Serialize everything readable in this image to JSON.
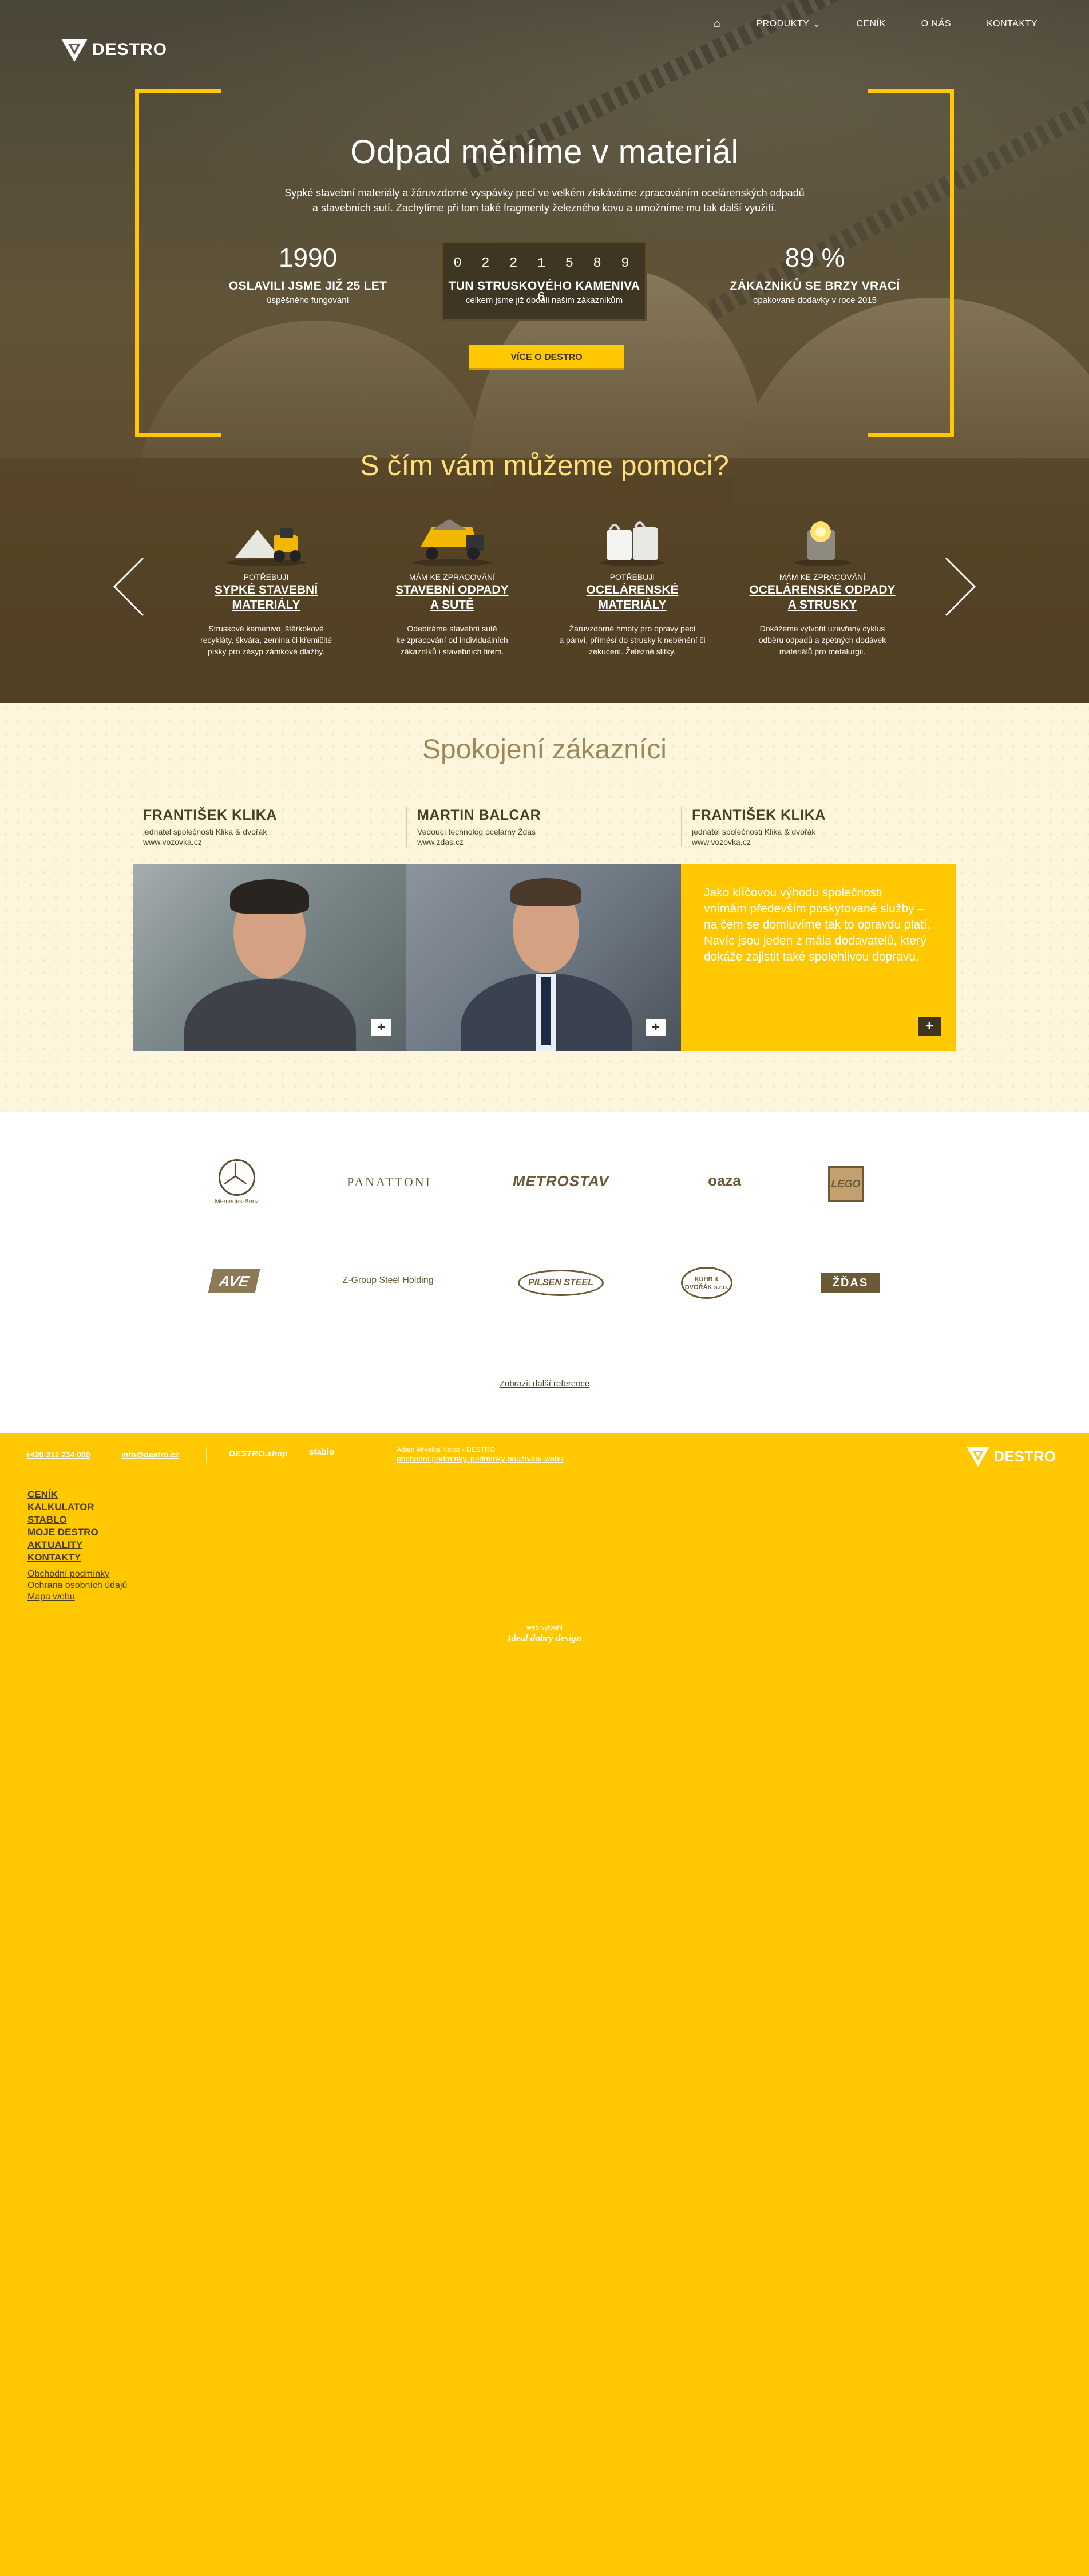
{
  "brand": {
    "name": "DESTRO"
  },
  "nav": {
    "home_icon": "home-icon",
    "items": [
      "PRODUKTY",
      "CENÍK",
      "O NÁS",
      "KONTAKTY"
    ]
  },
  "hero": {
    "title": "Odpad měníme v materiál",
    "subtitle_line1": "Sypké stavební materiály a žáruvzdorné vyspávky pecí ve velkém získáváme zpracováním ocelárenských odpadů",
    "subtitle_line2": "a stavebních sutí. Zachytíme při tom také fragmenty železného kovu a umožníme mu tak další využití.",
    "stats": [
      {
        "value": "1990",
        "label": "OSLAVILI JSME JIŽ 25 LET",
        "desc": "úspěšného fungování"
      },
      {
        "value": "0 2 2 1 5 8 9 6",
        "label": "TUN STRUSKOVÉHO KAMENIVA",
        "desc": "celkem jsme již dodali našim zákazníkům"
      },
      {
        "value": "89 %",
        "label": "ZÁKAZNÍKŮ SE BRZY VRACÍ",
        "desc": "opakované dodávky v roce 2015"
      }
    ],
    "button": "VÍCE O DESTRO"
  },
  "help": {
    "title": "S čím vám můžeme pomoci?",
    "cards": [
      {
        "pre": "POTŘEBUJI",
        "name1": "SYPKÉ STAVEBNÍ",
        "name2": "MATERIÁLY",
        "t1": "Struskové kamenivo, štěrkokové",
        "t2": "recykláty, škvára, zemina či křemičité",
        "t3": "písky pro zásyp zámkové dlažby."
      },
      {
        "pre": "MÁM KE ZPRACOVÁNÍ",
        "name1": "STAVEBNÍ ODPADY",
        "name2": "A SUTĚ",
        "t1": "Odebíráme stavební sutě",
        "t2": "ke zpracování od individuálních",
        "t3": "zákazníků i stavebních firem."
      },
      {
        "pre": "POTŘEBUJI",
        "name1": "OCELÁRENSKÉ",
        "name2": "MATERIÁLY",
        "t1": "Žáruvzdorné hmoty pro opravy pecí",
        "t2": "a pánví, přímésí do strusky k neběnéní či",
        "t3": "zekucení. Železné slitky."
      },
      {
        "pre": "MÁM KE ZPRACOVÁNÍ",
        "name1": "OCELÁRENSKÉ ODPADY",
        "name2": "A STRUSKY",
        "t1": "Dokážeme vytvořit uzavřený cyklus",
        "t2": "odběru odpadů a zpětných dodávek",
        "t3": "materiálů pro metalurgii."
      }
    ]
  },
  "testimonials": {
    "title": "Spokojení zákazníci",
    "people": [
      {
        "name": "FRANTIŠEK KLIKA",
        "role": "jednatel společnosti Klika & dvořák",
        "link": "www.vozovka.cz"
      },
      {
        "name": "MARTIN BALCAR",
        "role": "Vedoucí technolog ocelárny Ždas",
        "link": "www.zdas.cz"
      },
      {
        "name": "FRANTIŠEK KLIKA",
        "role": "jednatel společnosti Klika & dvořák",
        "link": "www.vozovka.cz"
      }
    ],
    "quote": [
      "Jako klíčovou výhodu společnosti",
      "vnímám především poskytované služby –",
      "na čem se domluvíme tak to opravdu platí.",
      "Navíc jsou jeden z mála dodavatelů, který",
      "dokáže zajistit také spolehlivou dopravu."
    ],
    "plus": "+"
  },
  "logos": {
    "row1": [
      "Mercedes-Benz",
      "PANATTONI",
      "METROSTAV",
      "oaza",
      "LEGO"
    ],
    "row2": [
      "AVE",
      "Z-Group Steel Holding",
      "PILSEN STEEL",
      "KUHR & DVOŘÁK s.r.o.",
      "ŽĎAS"
    ],
    "more": "Zobrazit další reference"
  },
  "footer": {
    "phone": "+420 311 234 000",
    "email": "info@destro.cz",
    "brand1": "DESTRO.shop",
    "brand2": "stablo",
    "legal_line1": "Adam Mrvalka Karas - DESTRO",
    "legal_line2": "obchodní podmínky, podmínky používání webu",
    "menu": [
      "CENÍK",
      "KALKULATOR",
      "STABLO",
      "MOJE DESTRO",
      "AKTUALITY",
      "KONTAKTY"
    ],
    "sub": [
      "Obchodní podmínky",
      "Ochrana osobních údajů",
      "Mapa webu"
    ],
    "credit1": "web vytvořil",
    "credit2": "Ideal dobrý design"
  }
}
